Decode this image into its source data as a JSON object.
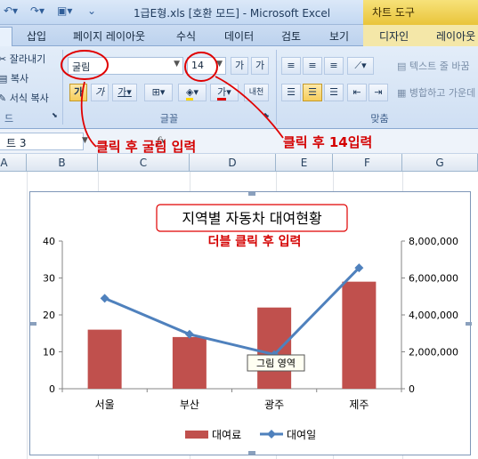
{
  "titlebar": {
    "title": "1급E형.xls  [호환 모드] - Microsoft Excel",
    "chart_tools": "차트 도구"
  },
  "tabs": [
    "삽입",
    "페이지 레이아웃",
    "수식",
    "데이터",
    "검토",
    "보기",
    "디자인",
    "레이아웃"
  ],
  "ribbon": {
    "clipboard": {
      "cut": "잘라내기",
      "copy": "복사",
      "format_painter": "서식 복사",
      "label": "드"
    },
    "font": {
      "font_name": "굴림",
      "font_size": "14",
      "grow_label": "가",
      "shrink_label": "가",
      "bold": "가",
      "italic": "가",
      "underline": "가",
      "phonetic": "내천",
      "font_color_label": "가",
      "label": "글꼴"
    },
    "align": {
      "wrap_text": "텍스트 줄 바꿈",
      "merge": "병합하고 가운데",
      "label": "맞춤"
    }
  },
  "formulabar": {
    "namebox": "트 3",
    "fx": "fx"
  },
  "columns": [
    "A",
    "B",
    "C",
    "D",
    "E",
    "F",
    "G"
  ],
  "annotations": {
    "font_note": "클릭 후 굴림 입력",
    "size_note": "클릭 후 14입력",
    "title_note": "더블 클릭 후 입력"
  },
  "tooltip": "그림 영역",
  "chart_data": {
    "type": "bar",
    "title": "지역별 자동차 대여현황",
    "categories": [
      "서울",
      "부산",
      "광주",
      "제주"
    ],
    "series": [
      {
        "name": "대여료",
        "type": "bar",
        "axis": "left",
        "color": "#c0504d",
        "values": [
          16,
          14,
          22,
          29
        ]
      },
      {
        "name": "대여일",
        "type": "line",
        "axis": "right",
        "color": "#4f81bd",
        "values": [
          4900000,
          2950000,
          1850000,
          6550000
        ]
      }
    ],
    "ylim_left": [
      0,
      40
    ],
    "yticks_left": [
      "0",
      "10",
      "20",
      "30",
      "40"
    ],
    "ylim_right": [
      0,
      8000000
    ],
    "yticks_right": [
      "0",
      "2,000,000",
      "4,000,000",
      "6,000,000",
      "8,000,000"
    ],
    "grid": false,
    "legend": "bottom"
  }
}
